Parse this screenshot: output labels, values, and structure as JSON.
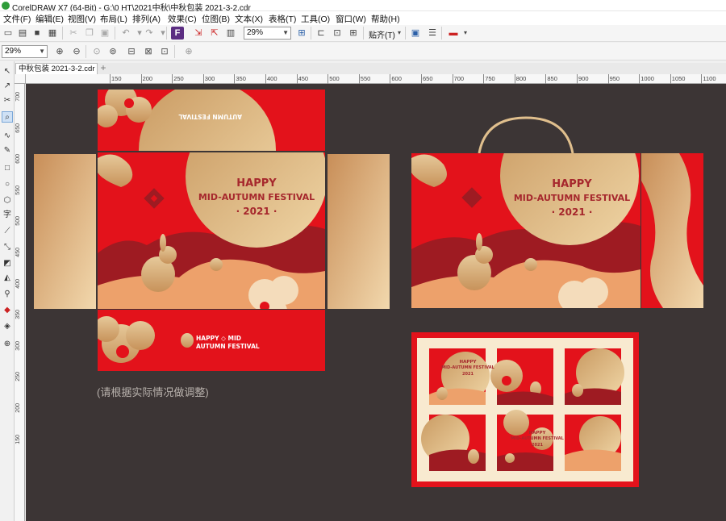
{
  "app": {
    "title": "CorelDRAW X7 (64-Bit) - G:\\0 HT\\2021中秋\\中秋包装 2021-3-2.cdr"
  },
  "menu": [
    "文件(F)",
    "编辑(E)",
    "视图(V)",
    "布局(L)",
    "排列(A)",
    "效果(C)",
    "位图(B)",
    "文本(X)",
    "表格(T)",
    "工具(O)",
    "窗口(W)",
    "帮助(H)"
  ],
  "toolbar": {
    "zoom_value": "29%",
    "snap_label": "贴齐(T)"
  },
  "toolbar2": {
    "zoom_value": "29%"
  },
  "document_tab": {
    "label": "中秋包装 2021-3-2.cdr"
  },
  "ruler": {
    "h_labels": [
      "150",
      "200",
      "250",
      "300",
      "350",
      "400",
      "450",
      "500",
      "550",
      "600",
      "650",
      "700",
      "750",
      "800",
      "850",
      "900",
      "950",
      "1000",
      "1050",
      "1100",
      "1150"
    ],
    "v_labels": [
      "700",
      "650",
      "600",
      "550",
      "500",
      "450",
      "400",
      "350",
      "300",
      "250",
      "200",
      "150"
    ]
  },
  "canvas": {
    "note": "(请根据实际情况做调整)",
    "design_text": {
      "happy": "HAPPY",
      "festival": "MID-AUTUMN FESTIVAL",
      "year": "· 2021 ·",
      "band_line1": "HAPPY ◇ MID",
      "band_line2": "AUTUMN FESTIVAL",
      "small_happy": "HAPPY",
      "small_festival": "MID-AUTUMN FESTIVAL",
      "small_year": "2021"
    }
  },
  "colors": {
    "canvas_bg": "#3c3535",
    "red": "#e3121b",
    "dark_red": "#9e1b22",
    "gold": "#dcb483",
    "peach": "#eda16b",
    "cream": "#f8ead0"
  }
}
